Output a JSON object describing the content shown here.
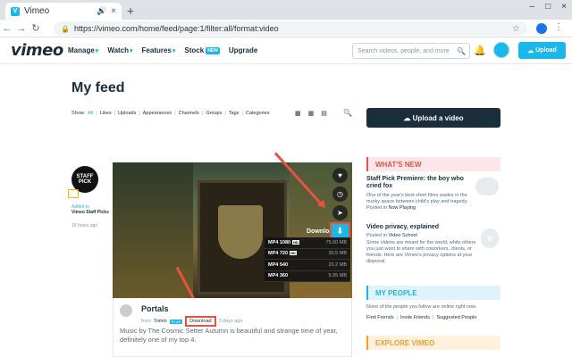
{
  "browser": {
    "tab_title": "Vimeo",
    "url": "https://vimeo.com/home/feed/page:1/filter:all/format:video"
  },
  "header": {
    "logo": "vimeo",
    "nav": [
      {
        "label": "Manage"
      },
      {
        "label": "Watch"
      },
      {
        "label": "Features"
      },
      {
        "label": "Stock",
        "badge": "NEW"
      },
      {
        "label": "Upgrade"
      }
    ],
    "search_placeholder": "Search videos, people, and more",
    "upload_label": "Upload"
  },
  "page": {
    "title": "My feed",
    "show_label": "Show:",
    "filters": [
      "All",
      "Likes",
      "Uploads",
      "Appearances",
      "Channels",
      "Groups",
      "Tags",
      "Categories"
    ],
    "upload_video_label": "Upload a video"
  },
  "feed_item": {
    "badge_text": "STAFF PICK",
    "added_to": "Added to",
    "channel": "Vimeo Staff Picks",
    "time_ago": "18 hours ago",
    "download_label": "Download",
    "download_options": [
      {
        "quality": "MP4 1080",
        "hd": "HD",
        "size": "75.00 MB"
      },
      {
        "quality": "MP4 720",
        "hd": "HD",
        "size": "30.5 MB"
      },
      {
        "quality": "MP4 540",
        "hd": "",
        "size": "20.2 MB"
      },
      {
        "quality": "MP4 360",
        "hd": "",
        "size": "5.95 MB"
      }
    ],
    "video_title": "Portals",
    "from_label": "from",
    "author": "Tomin",
    "author_badge": "PLUS",
    "download_link": "Download",
    "posted": "3 days ago",
    "description": "Music by The Cosmic Setter Autumn is beautiful and strange time of year, definitely one of my top 4."
  },
  "sidebar": {
    "whats_new": {
      "heading": "WHAT'S NEW",
      "items": [
        {
          "title": "Staff Pick Premiere: the boy who cried fox",
          "text": "One of the year's best short films wades in the murky space between child's play and tragedy.",
          "posted_in_label": "Posted in",
          "posted_in": "Now Playing"
        },
        {
          "title": "Video privacy, explained",
          "posted_in_label": "Posted in",
          "posted_in": "Video School",
          "text": "Some videos are meant for the world, while others you just want to share with coworkers, clients, or friends. Here are Vimeo's privacy options at your disposal."
        }
      ]
    },
    "my_people": {
      "heading": "MY PEOPLE",
      "text": "None of the people you follow are online right now.",
      "links": [
        "Find Friends",
        "Invite Friends",
        "Suggested People"
      ]
    },
    "explore": {
      "heading": "EXPLORE VIMEO"
    }
  },
  "colors": {
    "brand": "#1ab7ea",
    "navy": "#1a2e3b",
    "annotation": "#e8523f"
  }
}
